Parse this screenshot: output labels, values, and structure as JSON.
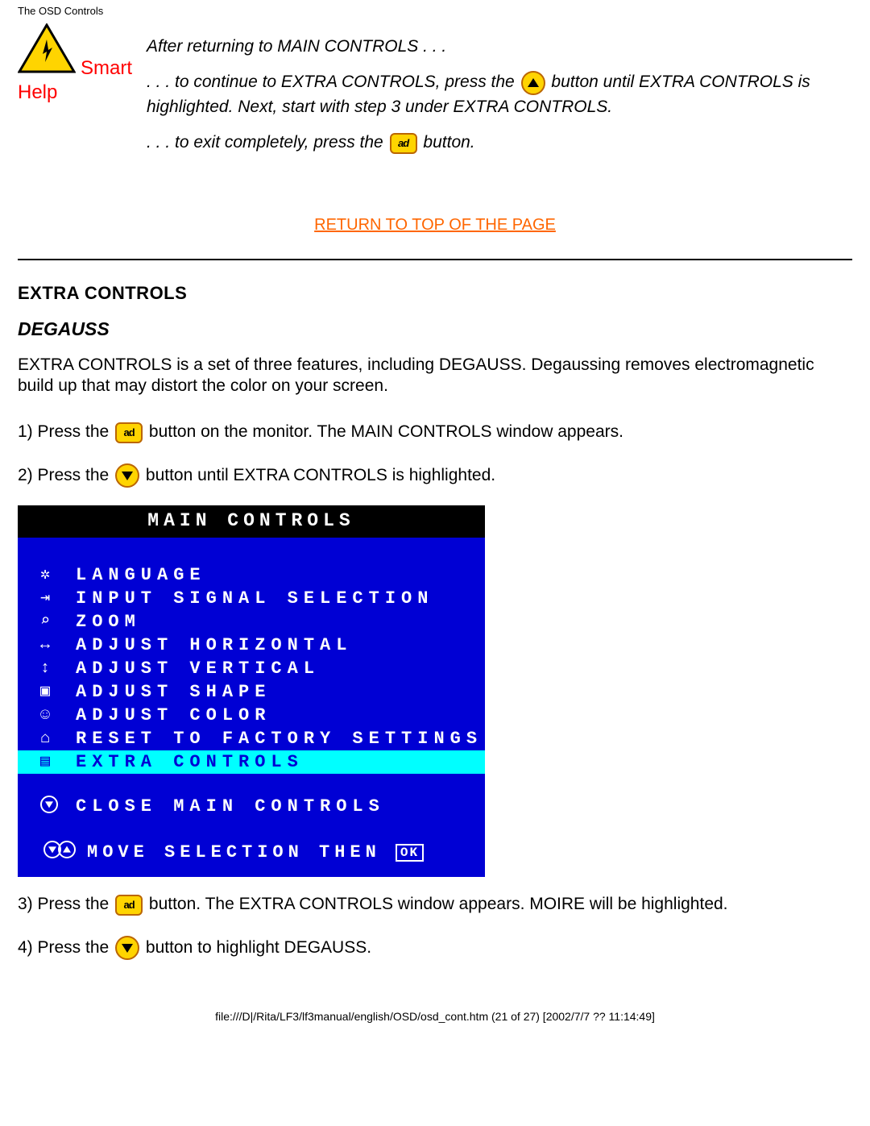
{
  "header_path": "The OSD Controls",
  "smart_help": {
    "line1": "Smart",
    "line2": "Help"
  },
  "instructions": {
    "after": "After returning to MAIN CONTROLS . . .",
    "continue_a": ". . . to continue to EXTRA CONTROLS, press the ",
    "continue_b": " button until EXTRA CONTROLS is highlighted. Next, start with step 3 under EXTRA CONTROLS.",
    "exit_a": ". . . to exit completely, press the ",
    "exit_b": " button."
  },
  "return_link": "RETURN TO TOP OF THE PAGE",
  "section_title": "EXTRA CONTROLS",
  "subsection_title": "DEGAUSS",
  "intro_para": "EXTRA CONTROLS is a set of three features, including DEGAUSS. Degaussing removes electromagnetic build up that may distort the color on your screen.",
  "steps": {
    "s1a": "1) Press the ",
    "s1b": " button on the monitor. The MAIN CONTROLS window appears.",
    "s2a": "2) Press the ",
    "s2b": " button until EXTRA CONTROLS is highlighted.",
    "s3a": "3) Press the ",
    "s3b": " button. The EXTRA CONTROLS window appears. MOIRE will be highlighted.",
    "s4a": "4) Press the ",
    "s4b": " button to highlight DEGAUSS."
  },
  "osd": {
    "title": "MAIN CONTROLS",
    "items": [
      {
        "label": "LANGUAGE",
        "highlight": false
      },
      {
        "label": "INPUT SIGNAL SELECTION",
        "highlight": false
      },
      {
        "label": "ZOOM",
        "highlight": false
      },
      {
        "label": "ADJUST HORIZONTAL",
        "highlight": false
      },
      {
        "label": "ADJUST VERTICAL",
        "highlight": false
      },
      {
        "label": "ADJUST SHAPE",
        "highlight": false
      },
      {
        "label": "ADJUST COLOR",
        "highlight": false
      },
      {
        "label": "RESET TO FACTORY SETTINGS",
        "highlight": false
      },
      {
        "label": "EXTRA CONTROLS",
        "highlight": true
      }
    ],
    "close": "CLOSE MAIN CONTROLS",
    "footer": "MOVE SELECTION THEN"
  },
  "footer_path": "file:///D|/Rita/LF3/lf3manual/english/OSD/osd_cont.htm (21 of 27) [2002/7/7 ?? 11:14:49]"
}
